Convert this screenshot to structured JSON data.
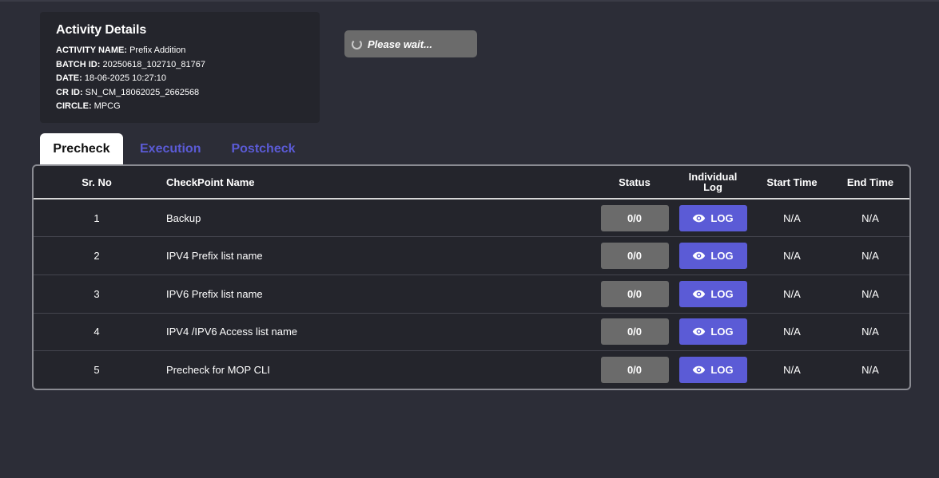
{
  "activity": {
    "title": "Activity Details",
    "details": [
      {
        "label": "ACTIVITY NAME:",
        "value": "Prefix Addition"
      },
      {
        "label": "BATCH ID:",
        "value": "20250618_102710_81767"
      },
      {
        "label": "DATE:",
        "value": "18-06-2025 10:27:10"
      },
      {
        "label": "CR ID:",
        "value": "SN_CM_18062025_2662568"
      },
      {
        "label": "CIRCLE:",
        "value": "MPCG"
      }
    ]
  },
  "wait": {
    "text": "Please wait..."
  },
  "tabs": [
    {
      "label": "Precheck",
      "active": true
    },
    {
      "label": "Execution",
      "active": false
    },
    {
      "label": "Postcheck",
      "active": false
    }
  ],
  "table": {
    "headers": {
      "sr": "Sr. No",
      "name": "CheckPoint Name",
      "status": "Status",
      "log_line1": "Individual",
      "log_line2": "Log",
      "start": "Start Time",
      "end": "End Time"
    },
    "rows": [
      {
        "sr": "1",
        "name": "Backup",
        "status": "0/0",
        "log": "LOG",
        "start": "N/A",
        "end": "N/A"
      },
      {
        "sr": "2",
        "name": "IPV4 Prefix list name",
        "status": "0/0",
        "log": "LOG",
        "start": "N/A",
        "end": "N/A"
      },
      {
        "sr": "3",
        "name": "IPV6 Prefix list name",
        "status": "0/0",
        "log": "LOG",
        "start": "N/A",
        "end": "N/A"
      },
      {
        "sr": "4",
        "name": "IPV4 /IPV6 Access list name",
        "status": "0/0",
        "log": "LOG",
        "start": "N/A",
        "end": "N/A"
      },
      {
        "sr": "5",
        "name": "Precheck for MOP CLI",
        "status": "0/0",
        "log": "LOG",
        "start": "N/A",
        "end": "N/A"
      }
    ]
  },
  "icons": {
    "log_button": "eye-icon",
    "wait": "spinner-icon"
  },
  "colors": {
    "background": "#2c2d37",
    "card": "#24252c",
    "accent": "#5b5bd6",
    "status_pill": "#6b6b6b"
  }
}
